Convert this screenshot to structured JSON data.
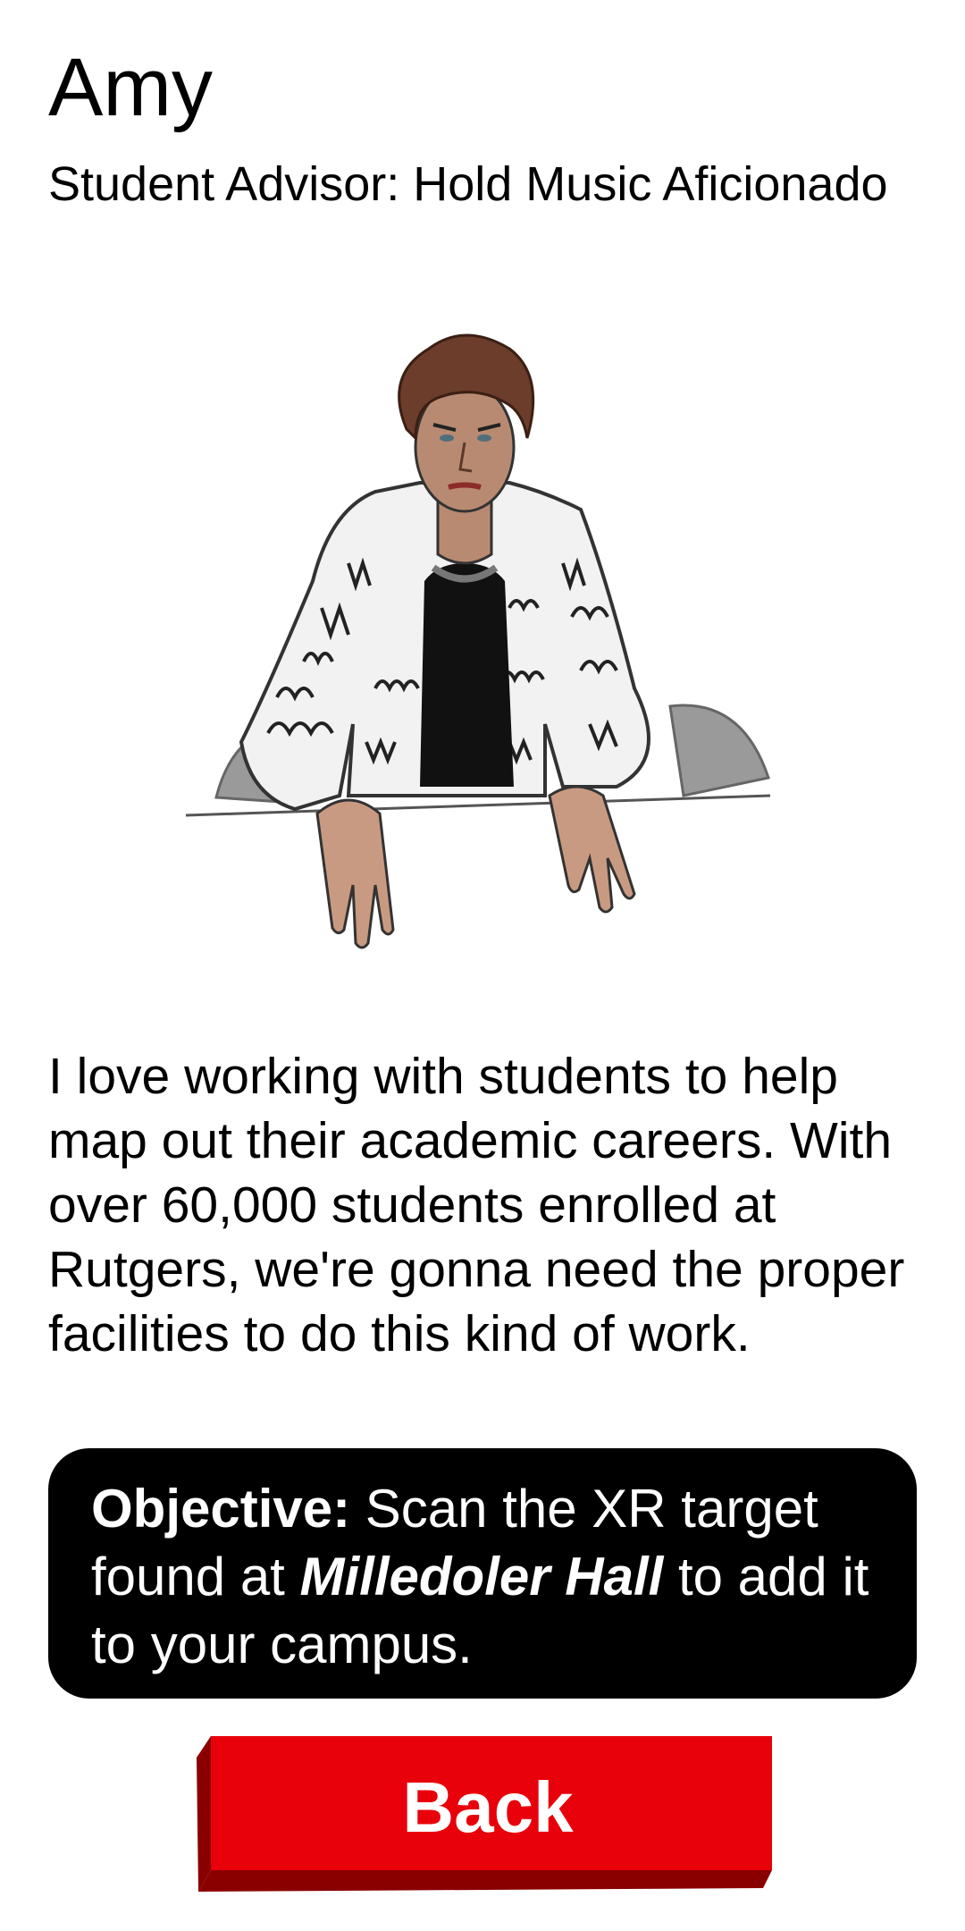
{
  "profile": {
    "name": "Amy",
    "role": "Student Advisor: Hold Music Aficionado",
    "portrait_icon": "advisor-portrait-illustration",
    "bio": "I love working with students to help map out their academic careers. With over 60,000 students enrolled at Rutgers, we're gonna need the proper facilities to do this kind of work."
  },
  "objective": {
    "label": "Objective:",
    "text_before": " Scan the XR target found at ",
    "location": "Milledoler Hall",
    "text_after": " to add it to your campus."
  },
  "back_button": {
    "label": "Back",
    "color": "#e8000b"
  }
}
